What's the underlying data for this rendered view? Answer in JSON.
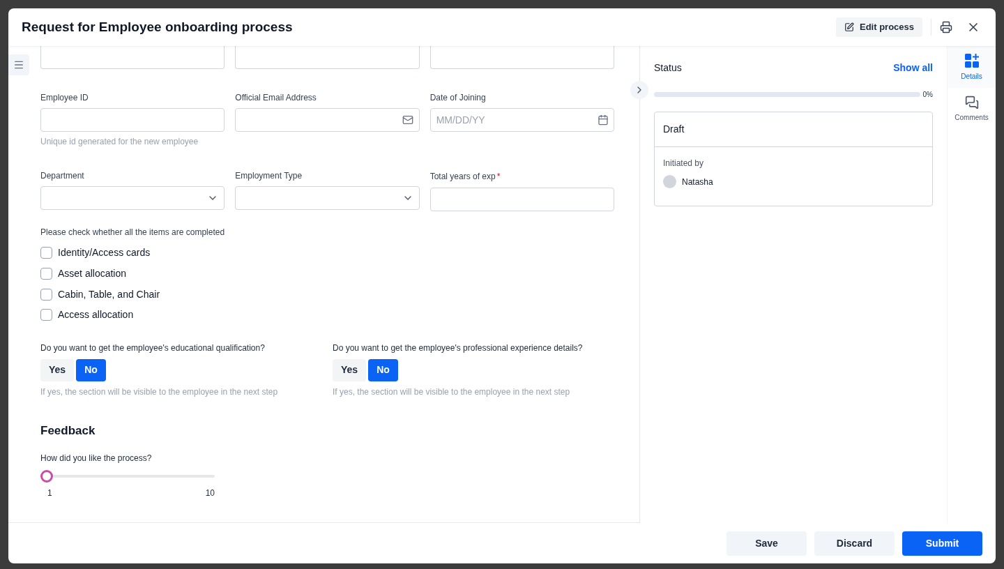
{
  "dialog": {
    "title": "Request for Employee onboarding process",
    "edit_button": "Edit process"
  },
  "form": {
    "field_rows": [
      {
        "fields": [
          {
            "label": "Employee ID",
            "kind": "text",
            "helper": "Unique id generated for the new employee"
          },
          {
            "label": "Official Email Address",
            "kind": "email"
          },
          {
            "label": "Date of Joining",
            "kind": "date",
            "placeholder": "MM/DD/YY"
          }
        ]
      },
      {
        "fields": [
          {
            "label": "Department",
            "kind": "select"
          },
          {
            "label": "Employment Type",
            "kind": "select"
          },
          {
            "label": "Total years of exp",
            "required_mark": "*",
            "kind": "text"
          }
        ]
      }
    ],
    "checklist": {
      "title": "Please check whether all the items are completed",
      "items": [
        {
          "label": "Identity/Access cards",
          "checked": false
        },
        {
          "label": "Asset allocation",
          "checked": false
        },
        {
          "label": "Cabin, Table, and Chair",
          "checked": false
        },
        {
          "label": "Access allocation",
          "checked": false
        }
      ]
    },
    "questions": [
      {
        "label": "Do you want to get the employee's educational qualification?",
        "options": [
          {
            "label": "Yes",
            "selected": false
          },
          {
            "label": "No",
            "selected": true
          }
        ],
        "helper": "If yes, the section will be visible to the employee in the next step"
      },
      {
        "label": "Do you want to get the employee's professional experience details?",
        "options": [
          {
            "label": "Yes",
            "selected": false
          },
          {
            "label": "No",
            "selected": true
          }
        ],
        "helper": "If yes, the section will be visible to the employee in the next step"
      }
    ],
    "feedback": {
      "title": "Feedback",
      "question": "How did you like the process?",
      "level": 0,
      "min_label": "1",
      "max_label": "10"
    }
  },
  "status_panel": {
    "title": "Status",
    "link": "Show all",
    "level": 0,
    "reading": "0%",
    "card": {
      "state": "Draft",
      "initiated_label": "Initiated by",
      "user": "Natasha"
    }
  },
  "rail": [
    {
      "label": "Details",
      "selected": true,
      "kind": "details"
    },
    {
      "label": "Comments",
      "selected": false,
      "kind": "comments"
    }
  ],
  "footer": [
    {
      "label": "Save",
      "kind": "secondary"
    },
    {
      "label": "Discard",
      "kind": "secondary"
    },
    {
      "label": "Submit",
      "kind": "primary"
    }
  ]
}
